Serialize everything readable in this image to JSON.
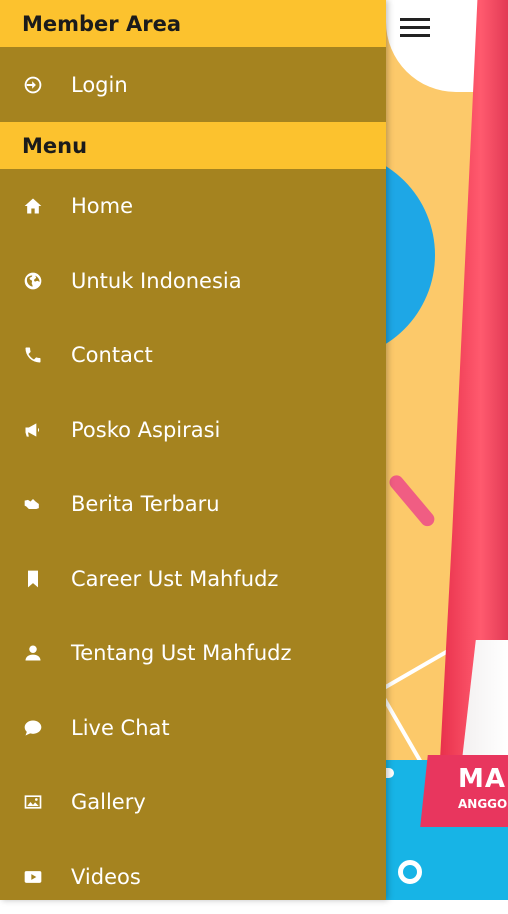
{
  "drawer": {
    "member_area_title": "Member Area",
    "login_label": "Login",
    "menu_title": "Menu",
    "items": [
      {
        "label": "Home",
        "icon": "home-icon"
      },
      {
        "label": "Untuk Indonesia",
        "icon": "globe-icon"
      },
      {
        "label": "Contact",
        "icon": "phone-icon"
      },
      {
        "label": "Posko Aspirasi",
        "icon": "megaphone-icon"
      },
      {
        "label": "Berita Terbaru",
        "icon": "news-icon"
      },
      {
        "label": "Career Ust Mahfudz",
        "icon": "bookmark-icon"
      },
      {
        "label": "Tentang Ust Mahfudz",
        "icon": "user-icon"
      },
      {
        "label": "Live Chat",
        "icon": "chat-icon"
      },
      {
        "label": "Gallery",
        "icon": "image-icon"
      },
      {
        "label": "Videos",
        "icon": "video-icon"
      }
    ]
  },
  "hero": {
    "banner_title": "MA",
    "banner_subtitle": "ANGGO"
  },
  "colors": {
    "drawer_bg": "#a5831f",
    "header_bg": "#fcc22e",
    "hero_bg": "#fcc96a"
  }
}
